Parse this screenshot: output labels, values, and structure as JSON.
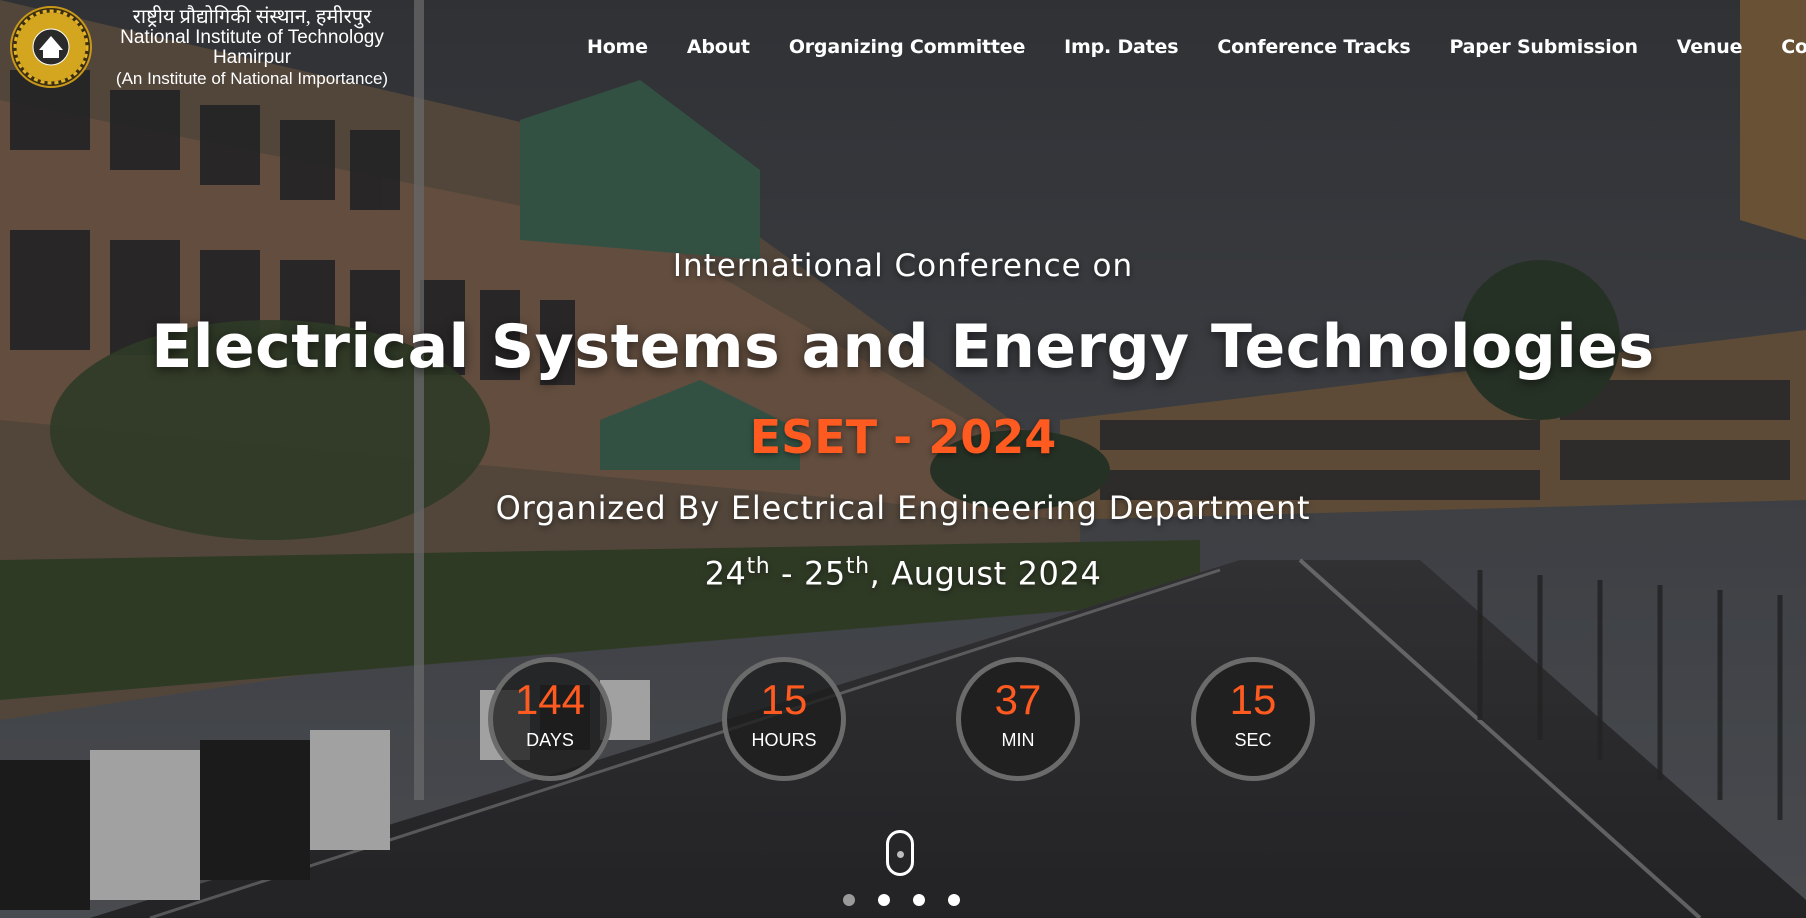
{
  "brand": {
    "hindi": "राष्ट्रीय प्रौद्योगिकी संस्थान, हमीरपुर",
    "line1": "National Institute of Technology",
    "line2": "Hamirpur",
    "line3": "(An Institute of National Importance)",
    "logo_icon": "institute-seal-icon"
  },
  "nav": {
    "items": [
      {
        "label": "Home"
      },
      {
        "label": "About"
      },
      {
        "label": "Organizing Committee"
      },
      {
        "label": "Imp. Dates"
      },
      {
        "label": "Conference Tracks"
      },
      {
        "label": "Paper Submission"
      },
      {
        "label": "Venue"
      },
      {
        "label": "Contact"
      }
    ]
  },
  "hero": {
    "pre_title": "International Conference on",
    "title": "Electrical Systems and Energy Technologies",
    "acronym": "ESET - 2024",
    "organized_by": "Organized By Electrical Engineering Department",
    "date_start_day": "24",
    "date_start_suffix": "th",
    "date_sep": " - ",
    "date_end_day": "25",
    "date_end_suffix": "th",
    "date_rest": ", August 2024"
  },
  "countdown": {
    "days": {
      "value": "144",
      "label": "DAYS"
    },
    "hours": {
      "value": "15",
      "label": "HOURS"
    },
    "min": {
      "value": "37",
      "label": "MIN"
    },
    "sec": {
      "value": "15",
      "label": "SEC"
    }
  },
  "carousel": {
    "slide_count": 4,
    "active_index": 0
  },
  "colors": {
    "accent": "#ff5a1f",
    "text": "#ffffff"
  }
}
